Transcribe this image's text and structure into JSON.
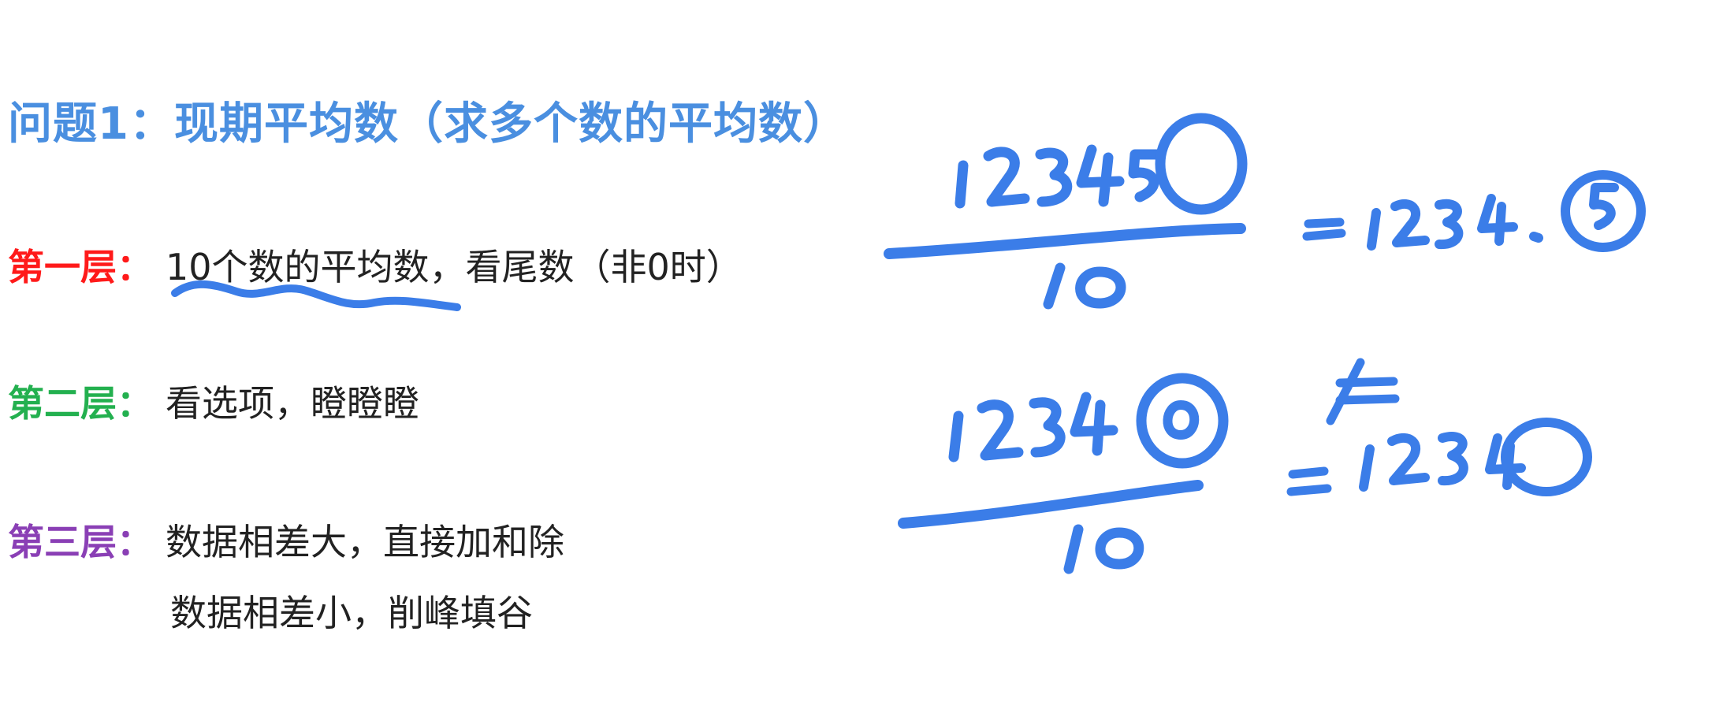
{
  "title": "问题1：现期平均数（求多个数的平均数）",
  "levels": [
    {
      "label": "第一层：",
      "color": "#ff1a1a",
      "lines": [
        "10个数的平均数，看尾数（非0时）"
      ]
    },
    {
      "label": "第二层：",
      "color": "#23b04f",
      "lines": [
        "看选项，瞪瞪瞪"
      ]
    },
    {
      "label": "第三层：",
      "color": "#8a3fb5",
      "lines": [
        "数据相差大，直接加和除",
        "数据相差小，削峰填谷"
      ]
    }
  ],
  "handwriting": {
    "color": "#3b7de8",
    "example1": {
      "numerator": "12345",
      "denominator": "10",
      "result": "=1234.5"
    },
    "example2": {
      "numerator": "12340",
      "denominator": "10",
      "mark": "≠",
      "result": "=1234"
    }
  }
}
